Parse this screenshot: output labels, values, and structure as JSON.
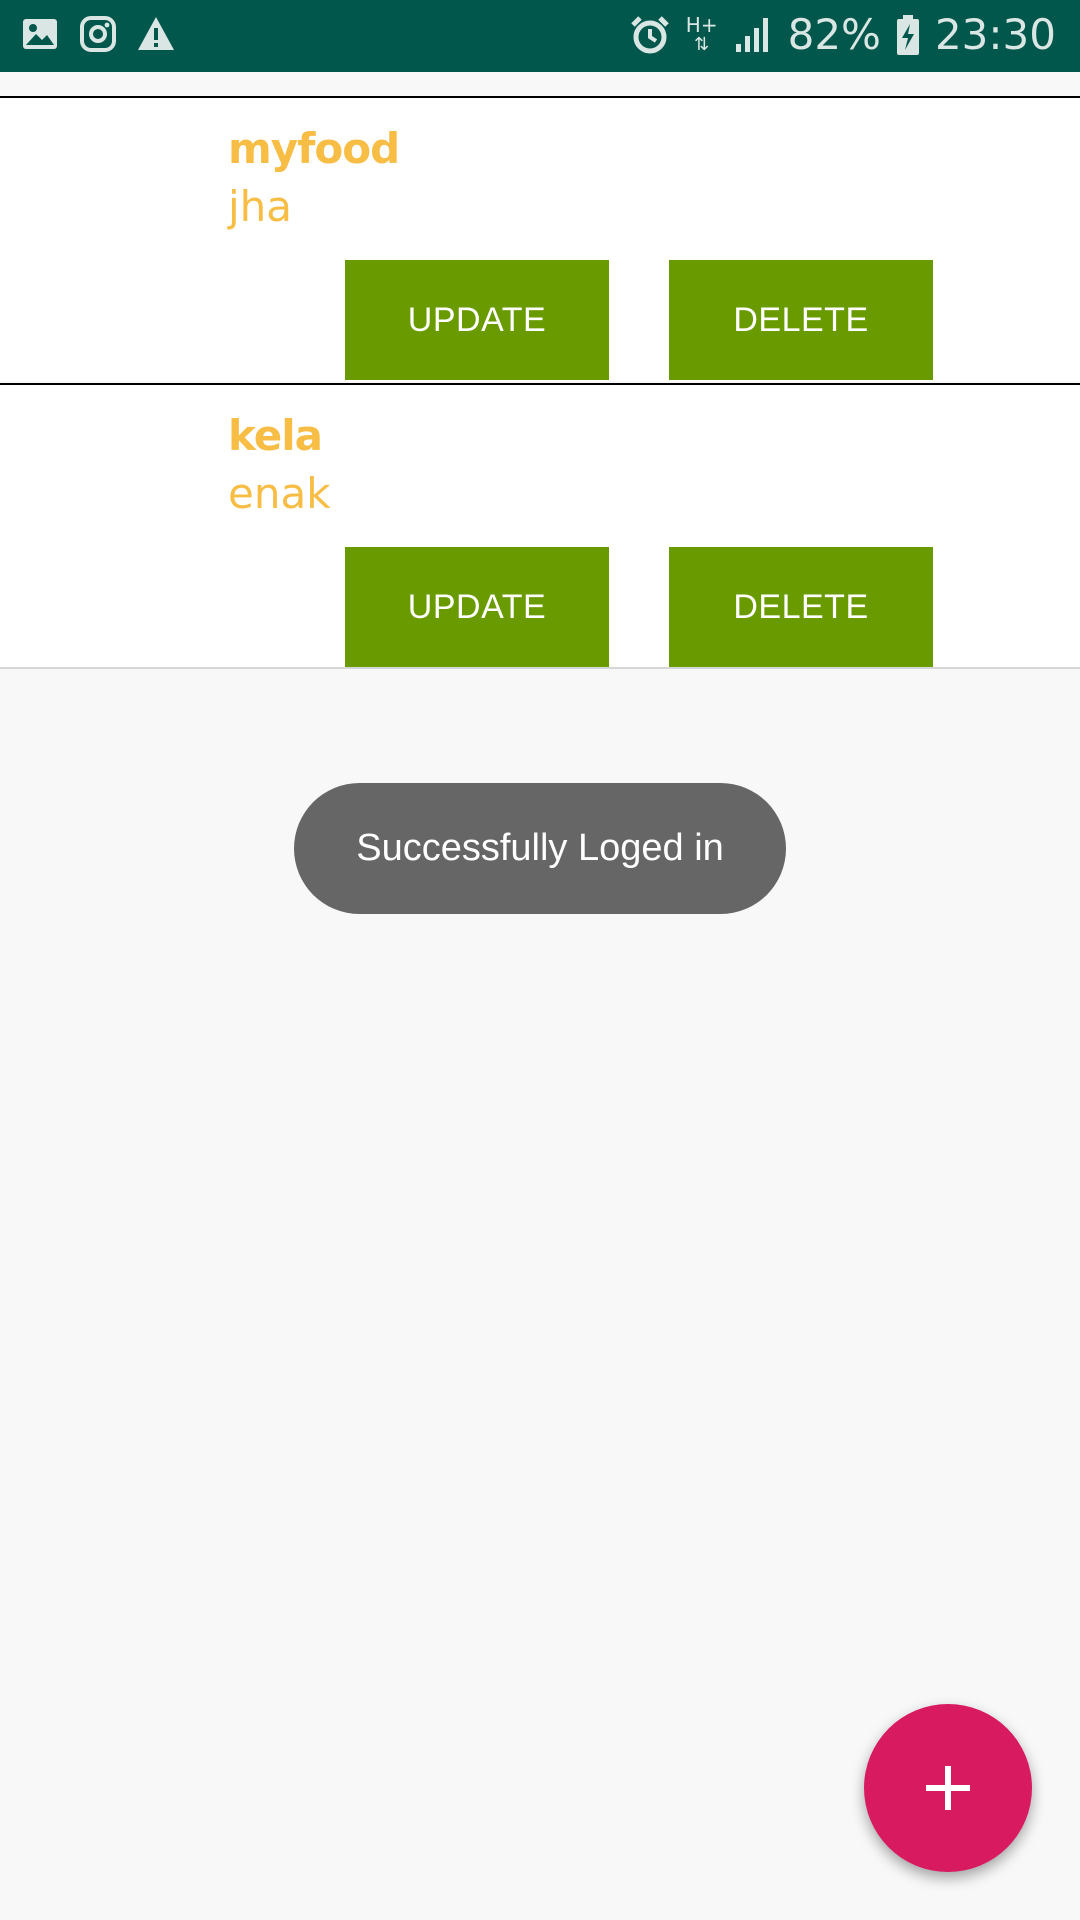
{
  "status_bar": {
    "left_icons": [
      "image-icon",
      "instagram-icon",
      "warning-icon"
    ],
    "network_type": "H+",
    "battery_percent": "82%",
    "time": "23:30",
    "background_color": "#01574c"
  },
  "food_list": [
    {
      "name": "myfood",
      "description": "jha",
      "update_label": "UPDATE",
      "delete_label": "DELETE"
    },
    {
      "name": "kela",
      "description": "enak",
      "update_label": "UPDATE",
      "delete_label": "DELETE"
    }
  ],
  "toast": {
    "message": "Successfully Loged in"
  },
  "fab": {
    "icon": "plus-icon",
    "color": "#d81b60"
  },
  "colors": {
    "title_text": "#f7bd45",
    "button_bg": "#699b00"
  }
}
